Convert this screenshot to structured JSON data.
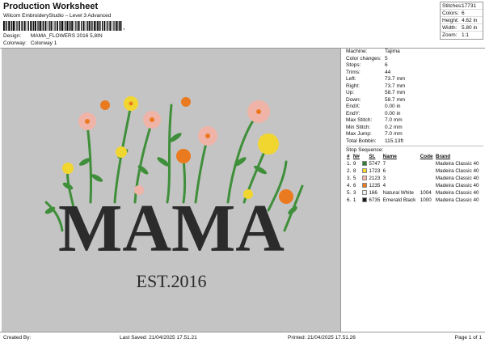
{
  "header": {
    "title": "Production Worksheet",
    "subtitle": "Wilcom EmbroideryStudio – Level 3 Advanced",
    "comma": ","
  },
  "design": {
    "design_label": "Design:",
    "design_value": "MAMA_FLOWERS 2016 5,8IN",
    "colorway_label": "Colorway:",
    "colorway_value": "Colorway 1"
  },
  "stats": [
    {
      "label": "Stitches:",
      "value": "17731"
    },
    {
      "label": "Colors:",
      "value": "6"
    },
    {
      "label": "Height:",
      "value": "4.62 in"
    },
    {
      "label": "Width:",
      "value": "5.80 in"
    },
    {
      "label": "Zoom:",
      "value": "1:1"
    }
  ],
  "machine_info": [
    {
      "label": "Machine:",
      "value": "Tajima"
    },
    {
      "label": "Color changes:",
      "value": "5"
    },
    {
      "label": "Stops:",
      "value": "6"
    },
    {
      "label": "Trims:",
      "value": "44"
    },
    {
      "label": "Left:",
      "value": "73.7 mm"
    },
    {
      "label": "Right:",
      "value": "73.7 mm"
    },
    {
      "label": "Up:",
      "value": "58.7 mm"
    },
    {
      "label": "Down:",
      "value": "58.7 mm"
    },
    {
      "label": "EndX:",
      "value": "0.00 in"
    },
    {
      "label": "EndY:",
      "value": "0.00 in"
    },
    {
      "label": "Max Stitch:",
      "value": "7.0 mm"
    },
    {
      "label": "Min Stitch:",
      "value": "0.2 mm"
    },
    {
      "label": "Max Jump:",
      "value": "7.0 mm"
    },
    {
      "label": "Total Bobbin:",
      "value": "115.13ft"
    }
  ],
  "stop_sequence": {
    "title": "Stop Sequence:",
    "headers": [
      "#",
      "N#",
      "St.",
      "Name",
      "Code",
      "Brand"
    ],
    "rows": [
      {
        "num": "1.",
        "n": "9",
        "color": "#2e7d32",
        "st": "5747",
        "name": "7",
        "code": "",
        "brand": "Madeira Classic 40"
      },
      {
        "num": "2.",
        "n": "8",
        "color": "#f2d630",
        "st": "1723",
        "name": "6",
        "code": "",
        "brand": "Madeira Classic 40"
      },
      {
        "num": "3.",
        "n": "5",
        "color": "#f2b8a8",
        "st": "2123",
        "name": "3",
        "code": "",
        "brand": "Madeira Classic 40"
      },
      {
        "num": "4.",
        "n": "6",
        "color": "#ea7a20",
        "st": "1235",
        "name": "4",
        "code": "",
        "brand": "Madeira Classic 40"
      },
      {
        "num": "5.",
        "n": "3",
        "color": "#f4f1ea",
        "st": "166",
        "name": "Natural White",
        "code": "1004",
        "brand": "Madeira Classic 40"
      },
      {
        "num": "6.",
        "n": "1",
        "color": "#1a1a1a",
        "st": "6735",
        "name": "Emerald Black",
        "code": "1000",
        "brand": "Madeira Classic 40"
      }
    ]
  },
  "artwork": {
    "word": "MAMA",
    "est": "EST.2016",
    "colors": {
      "background": "#c4c4c4",
      "letters": "#2b2b2b",
      "stem": "#3f8f3a",
      "yellow": "#f2d630",
      "pink": "#f0b3a8",
      "orange": "#ea7a20"
    }
  },
  "footer": {
    "created_by": "Created By:",
    "last_saved": "Last Saved: 21/04/2025 17.51.21",
    "printed": "Printed: 21/04/2025 17.51.26",
    "page": "Page 1 of 1"
  }
}
